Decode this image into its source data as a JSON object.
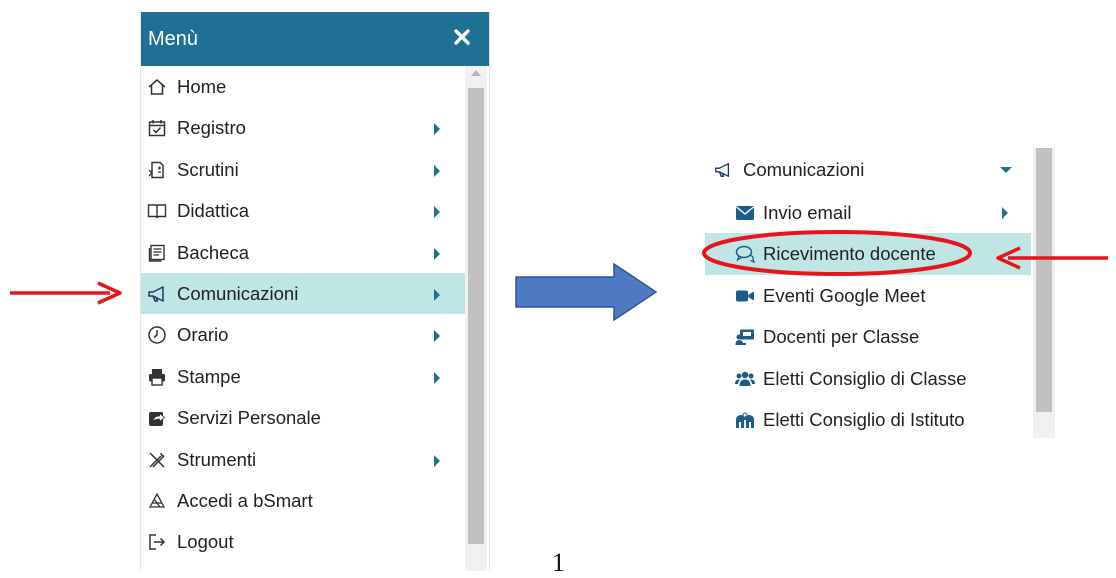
{
  "menu": {
    "title": "Menù",
    "items": [
      {
        "label": "Home",
        "icon": "home-icon",
        "submenu": false,
        "active": false
      },
      {
        "label": "Registro",
        "icon": "calendar-check-icon",
        "submenu": true,
        "active": false
      },
      {
        "label": "Scrutini",
        "icon": "scrutini-icon",
        "submenu": true,
        "active": false
      },
      {
        "label": "Didattica",
        "icon": "book-icon",
        "submenu": true,
        "active": false
      },
      {
        "label": "Bacheca",
        "icon": "bulletin-icon",
        "submenu": true,
        "active": false
      },
      {
        "label": "Comunicazioni",
        "icon": "megaphone-icon",
        "submenu": true,
        "active": true
      },
      {
        "label": "Orario",
        "icon": "clock-icon",
        "submenu": true,
        "active": false
      },
      {
        "label": "Stampe",
        "icon": "printer-icon",
        "submenu": true,
        "active": false
      },
      {
        "label": "Servizi Personale",
        "icon": "share-icon",
        "submenu": false,
        "active": false
      },
      {
        "label": "Strumenti",
        "icon": "tools-icon",
        "submenu": true,
        "active": false
      },
      {
        "label": "Accedi a bSmart",
        "icon": "bsmart-icon",
        "submenu": false,
        "active": false
      },
      {
        "label": "Logout",
        "icon": "logout-icon",
        "submenu": false,
        "active": false
      }
    ]
  },
  "submenu": {
    "header": {
      "label": "Comunicazioni",
      "icon": "megaphone-icon"
    },
    "items": [
      {
        "label": "Invio email",
        "icon": "envelope-icon",
        "submenu": true,
        "active": false
      },
      {
        "label": "Ricevimento docente",
        "icon": "chat-bubbles-icon",
        "submenu": false,
        "active": true
      },
      {
        "label": "Eventi Google Meet",
        "icon": "video-camera-icon",
        "submenu": false,
        "active": false
      },
      {
        "label": "Docenti per Classe",
        "icon": "teacher-board-icon",
        "submenu": false,
        "active": false
      },
      {
        "label": "Eletti Consiglio di Classe",
        "icon": "users-group-icon",
        "submenu": false,
        "active": false
      },
      {
        "label": "Eletti Consiglio di Istituto",
        "icon": "institute-icon",
        "submenu": false,
        "active": false
      }
    ]
  },
  "page_number": "1",
  "colors": {
    "header": "#1f7094",
    "active_row": "#bfe5e5",
    "annotation_red": "#e8141b",
    "blue_arrow": "#4f7ac1",
    "blue_arrow_border": "#2f5597"
  }
}
